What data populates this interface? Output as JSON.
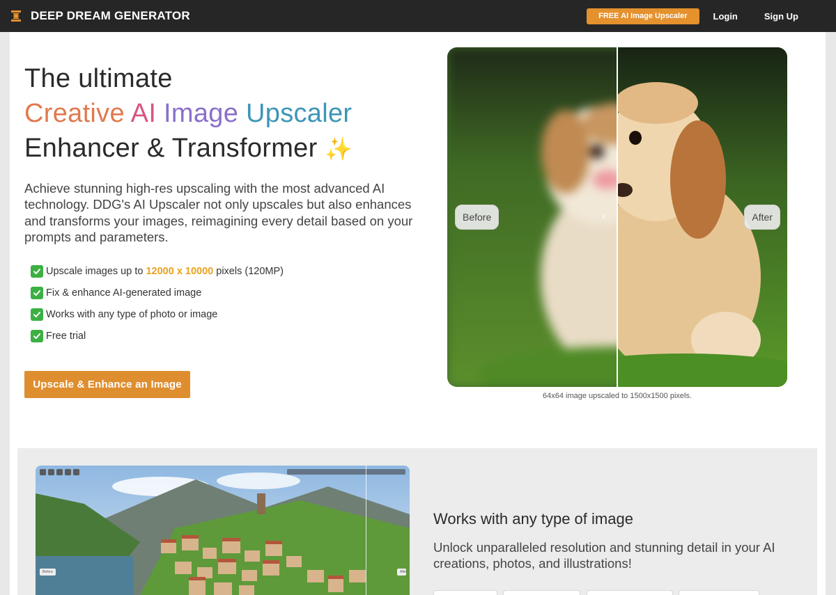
{
  "nav": {
    "brand": "DEEP DREAM GENERATOR",
    "cta": "FREE AI Image Upscaler",
    "login": "Login",
    "signup": "Sign Up"
  },
  "hero": {
    "title_line1": "The ultimate",
    "title_line2_words": [
      "Creative",
      "AI",
      "Image",
      "Upscaler"
    ],
    "title_line3": "Enhancer & Transformer",
    "sparkle": "✨",
    "description": "Achieve stunning high-res upscaling with the most advanced AI technology. DDG's AI Upscaler not only upscales but also enhances and transforms your images, reimagining every detail based on your prompts and parameters.",
    "features": [
      {
        "before": "Upscale images up to ",
        "highlight": "12000 x 10000",
        "after": " pixels (120MP)"
      },
      {
        "text": "Fix & enhance AI-generated image"
      },
      {
        "text": "Works with any type of photo or image"
      },
      {
        "text": "Free trial"
      }
    ],
    "button": "Upscale & Enhance an Image"
  },
  "comparison": {
    "before_label": "Before",
    "after_label": "After",
    "caption": "64x64 image upscaled to 1500x1500 pixels."
  },
  "section2": {
    "before_label": "Before",
    "after_label": "After",
    "title": "Works with any type of image",
    "description": "Unlock unparalleled resolution and stunning detail in your AI creations, photos, and illustrations!"
  },
  "colors": {
    "accent": "#df8e2f",
    "nav_bg": "#262626",
    "check_green": "#3cb043",
    "highlight": "#e8a21f"
  }
}
